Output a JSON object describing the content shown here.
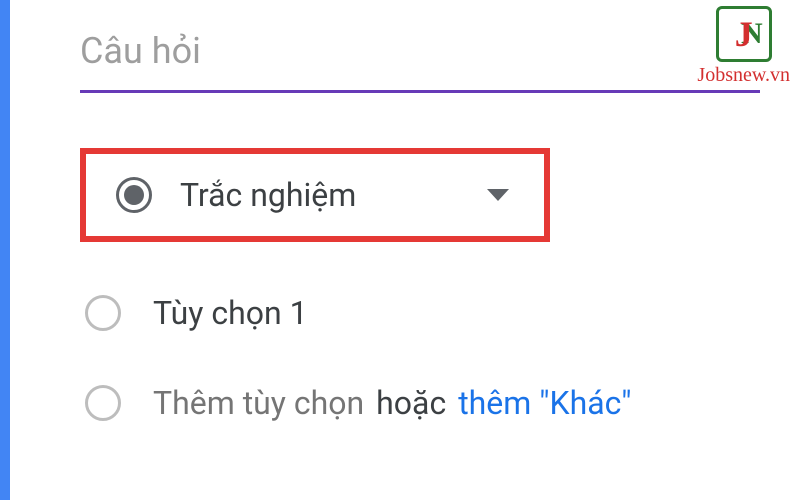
{
  "question": {
    "placeholder": "Câu hỏi",
    "value": ""
  },
  "question_type_selector": {
    "label": "Trắc nghiệm",
    "icon": "radio-selected"
  },
  "options": [
    {
      "label": "Tùy chọn 1"
    }
  ],
  "add_option": {
    "add_text": "Thêm tùy chọn",
    "or_text": "hoặc",
    "add_other_text": "thêm \"Khác\""
  },
  "watermark": {
    "text": "Jobsnew.vn"
  },
  "colors": {
    "accent": "#4285f4",
    "highlight_border": "#e53935",
    "input_underline": "#673ab7",
    "link": "#1a73e8"
  }
}
